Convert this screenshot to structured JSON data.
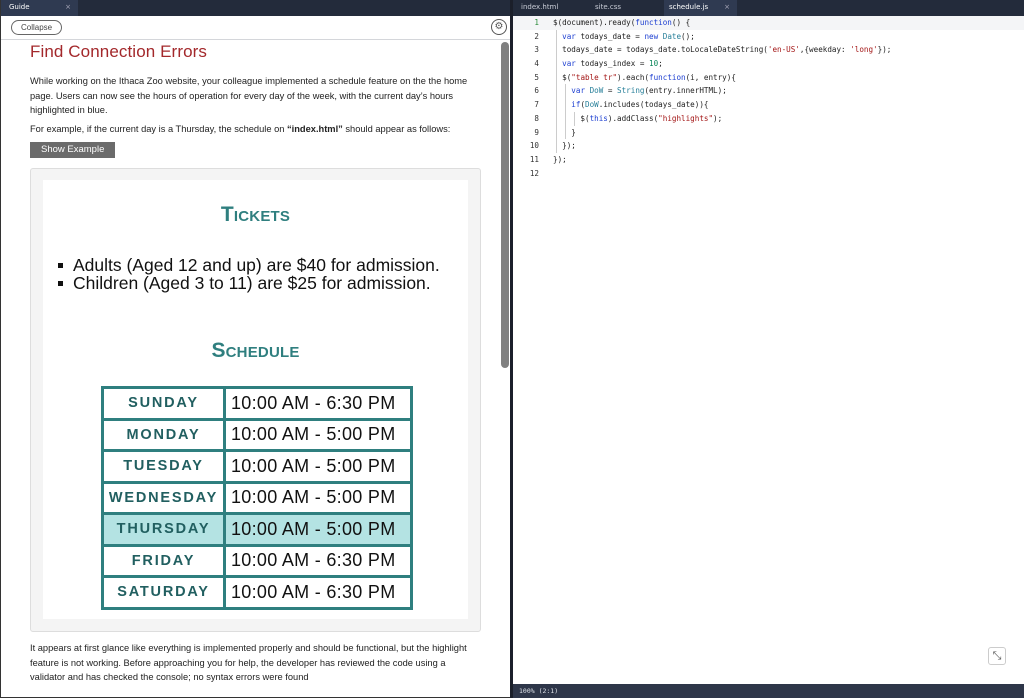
{
  "left_panel": {
    "tab": {
      "label": "Guide",
      "close": "×"
    },
    "collapse_label": "Collapse",
    "settings_icon": "gear-icon",
    "title": "Find Connection Errors",
    "intro": "While working on the Ithaca Zoo website, your colleague implemented a schedule feature on the the home page. Users can now see the hours of operation for every day of the week, with the current day’s hours highlighted in blue.",
    "example_prefix": "For example, if the current day is a Thursday, the schedule on ",
    "example_file": "“index.html”",
    "example_suffix": " should appear as follows:",
    "show_example_label": "Show Example",
    "example": {
      "tickets_title": "Tickets",
      "tickets": [
        "Adults (Aged 12 and up) are $40 for admission.",
        "Children (Aged 3 to 11) are $25 for admission."
      ],
      "schedule_title": "Schedule",
      "schedule": [
        {
          "day": "SUNDAY",
          "hours": "10:00 AM - 6:30 PM",
          "highlighted": false
        },
        {
          "day": "MONDAY",
          "hours": "10:00 AM - 5:00 PM",
          "highlighted": false
        },
        {
          "day": "TUESDAY",
          "hours": "10:00 AM - 5:00 PM",
          "highlighted": false
        },
        {
          "day": "WEDNESDAY",
          "hours": "10:00 AM - 5:00 PM",
          "highlighted": false
        },
        {
          "day": "THURSDAY",
          "hours": "10:00 AM - 5:00 PM",
          "highlighted": true
        },
        {
          "day": "FRIDAY",
          "hours": "10:00 AM - 6:30 PM",
          "highlighted": false
        },
        {
          "day": "SATURDAY",
          "hours": "10:00 AM - 6:30 PM",
          "highlighted": false
        }
      ],
      "highlight_color": "#b4e3e3",
      "accent_color": "#2f7f7f"
    },
    "bottom_text": "It appears at first glance like everything is implemented properly and should be functional, but the highlight feature is not working. Before approaching you for help, the developer has reviewed the code using a validator and has checked the console; no syntax errors were found"
  },
  "editor": {
    "tabs": [
      {
        "label": "index.html",
        "active": false
      },
      {
        "label": "site.css",
        "active": false
      },
      {
        "label": "schedule.js",
        "active": true,
        "close": "×"
      }
    ],
    "current_line": 1,
    "lines": [
      "$(document).ready(function() {",
      "  var todays_date = new Date();",
      "  todays_date = todays_date.toLocaleDateString('en-US',{weekday: 'long'});",
      "  var todays_index = 10;",
      "  $(\"table tr\").each(function(i, entry){",
      "    var DoW = String(entry.innerHTML);",
      "    if(DoW.includes(todays_date)){",
      "      $(this).addClass(\"highlights\");",
      "    }",
      "  });",
      "});",
      ""
    ],
    "status": "100% (2:1)",
    "fullscreen_icon": "compress-icon"
  }
}
